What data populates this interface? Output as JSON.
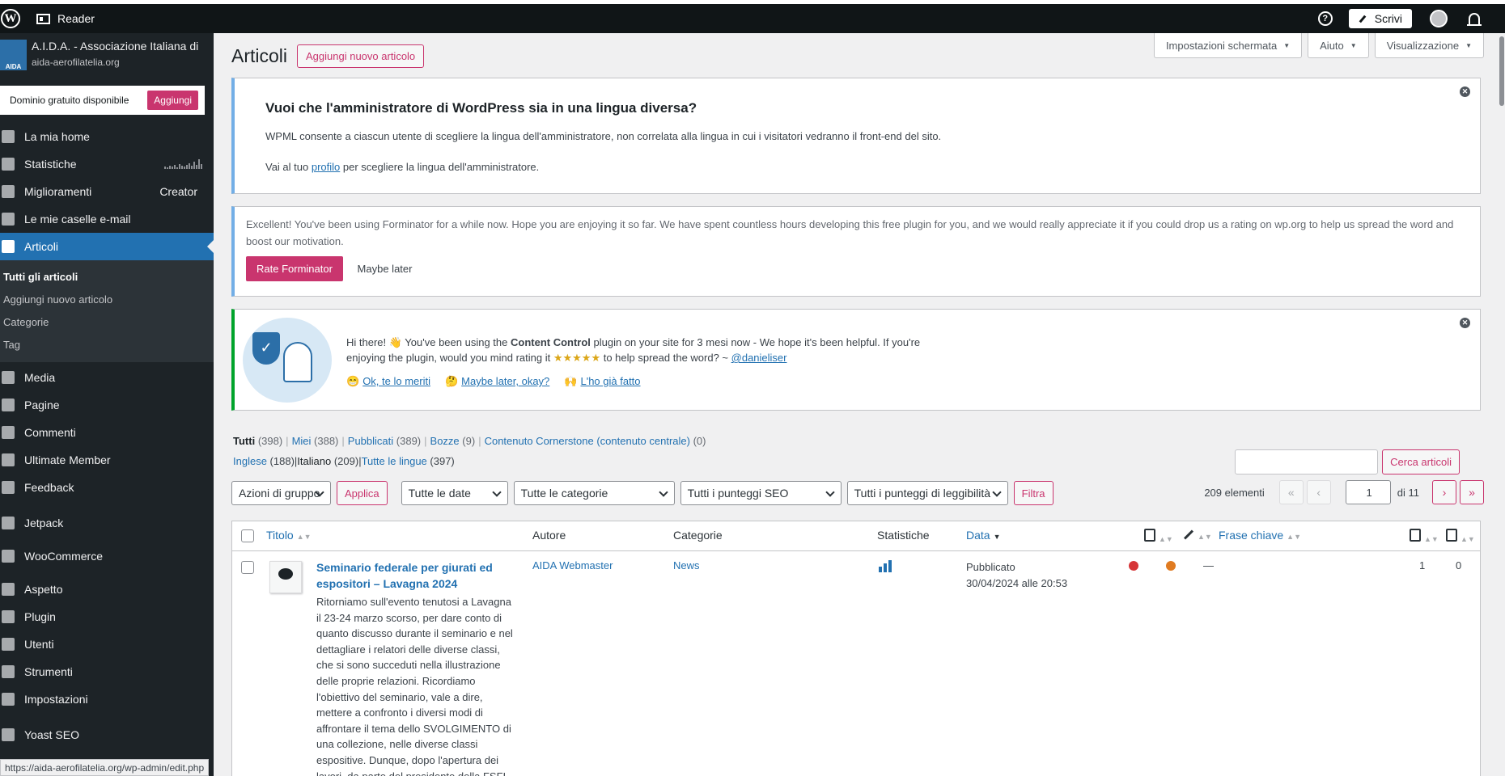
{
  "topbar": {
    "reader": "Reader",
    "write": "Scrivi",
    "help": "?"
  },
  "site": {
    "name": "A.I.D.A. - Associazione Italiana di",
    "url": "aida-aerofilatelia.org",
    "logo_text": "AIDA"
  },
  "promo": {
    "text": "Dominio gratuito disponibile",
    "button": "Aggiungi"
  },
  "sidebar": {
    "items": [
      {
        "label": "La mia home",
        "icon": "home-icon"
      },
      {
        "label": "Statistiche",
        "icon": "stats-icon"
      },
      {
        "label": "Miglioramenti",
        "icon": "cart-icon",
        "extra": "Creator"
      },
      {
        "label": "Le mie caselle e-mail",
        "icon": "mail-icon"
      },
      {
        "label": "Articoli",
        "icon": "pin-icon"
      }
    ],
    "submenu": [
      "Tutti gli articoli",
      "Aggiungi nuovo articolo",
      "Categorie",
      "Tag"
    ],
    "items2": [
      {
        "label": "Media",
        "icon": "media-icon"
      },
      {
        "label": "Pagine",
        "icon": "page-icon"
      },
      {
        "label": "Commenti",
        "icon": "comment-icon"
      },
      {
        "label": "Ultimate Member",
        "icon": "user-icon"
      },
      {
        "label": "Feedback",
        "icon": "feedback-icon"
      },
      {
        "label": "Jetpack",
        "icon": "jetpack-icon"
      },
      {
        "label": "WooCommerce",
        "icon": "woo-icon"
      },
      {
        "label": "Aspetto",
        "icon": "brush-icon"
      },
      {
        "label": "Plugin",
        "icon": "plugin-icon"
      },
      {
        "label": "Utenti",
        "icon": "users-icon"
      },
      {
        "label": "Strumenti",
        "icon": "tools-icon"
      },
      {
        "label": "Impostazioni",
        "icon": "settings-icon"
      },
      {
        "label": "Yoast SEO",
        "icon": "yoast-icon"
      }
    ]
  },
  "statusbar": "https://aida-aerofilatelia.org/wp-admin/edit.php",
  "screen_options": [
    "Impostazioni schermata",
    "Aiuto",
    "Visualizzazione"
  ],
  "page": {
    "title": "Articoli",
    "add_new": "Aggiungi nuovo articolo"
  },
  "notice_wpml": {
    "title": "Vuoi che l'amministratore di WordPress sia in una lingua diversa?",
    "body": "WPML consente a ciascun utente di scegliere la lingua dell'amministratore, non correlata alla lingua in cui i visitatori vedranno il front-end del sito.",
    "link_pre": "Vai al tuo ",
    "link": "profilo",
    "link_post": " per scegliere la lingua dell'amministratore."
  },
  "notice_forminator": {
    "body": "Excellent! You've been using Forminator for a while now. Hope you are enjoying it so far. We have spent countless hours developing this free plugin for you, and we would really appreciate it if you could drop us a rating on wp.org to help us spread the word and boost our motivation.",
    "rate": "Rate Forminator",
    "later": "Maybe later"
  },
  "notice_cc": {
    "pre": "Hi there! 👋 You've been using the ",
    "plugin": "Content Control",
    "mid": " plugin on your site for 3 mesi now - We hope it's been helpful. If you're enjoying the plugin, would you mind rating it ",
    "stars": "★★★★★",
    "post": " to help spread the word? ~ ",
    "author": "@danieliser",
    "links": [
      {
        "emoji": "😁",
        "label": "Ok, te lo meriti"
      },
      {
        "emoji": "🤔",
        "label": "Maybe later, okay?"
      },
      {
        "emoji": "🙌",
        "label": "L'ho già fatto"
      }
    ]
  },
  "views": [
    {
      "label": "Tutti",
      "count": "(398)"
    },
    {
      "label": "Miei",
      "count": "(388)"
    },
    {
      "label": "Pubblicati",
      "count": "(389)"
    },
    {
      "label": "Bozze",
      "count": "(9)"
    },
    {
      "label": "Contenuto Cornerstone (contenuto centrale)",
      "count": "(0)"
    }
  ],
  "langs": [
    {
      "label": "Inglese",
      "count": "(188)"
    },
    {
      "label": "Italiano",
      "count": "(209)"
    },
    {
      "label": "Tutte le lingue",
      "count": "(397)"
    }
  ],
  "search": {
    "button": "Cerca articoli"
  },
  "filters": {
    "bulk": "Azioni di gruppo",
    "apply": "Applica",
    "dates": "Tutte le date",
    "cats": "Tutte le categorie",
    "seo": "Tutti i punteggi SEO",
    "read": "Tutti i punteggi di leggibilità",
    "filter": "Filtra"
  },
  "pager": {
    "count": "209 elementi",
    "page": "1",
    "of": "di 11",
    "first": "«",
    "prev": "‹",
    "next": "›",
    "last": "»"
  },
  "table": {
    "headers": {
      "title": "Titolo",
      "author": "Autore",
      "cats": "Categorie",
      "stats": "Statistiche",
      "date": "Data",
      "keyphrase": "Frase chiave"
    },
    "row": {
      "title": "Seminario federale per giurati ed espositori – Lavagna 2024",
      "excerpt": [
        "Ritorniamo sull'evento tenutosi a Lavagna",
        "il 23-24 marzo scorso, per dare conto di",
        "quanto discusso durante il seminario e nel",
        "dettagliare i relatori delle diverse classi,",
        "che si sono succeduti nella illustrazione",
        "delle proprie relazioni. Ricordiamo",
        "l'obiettivo del seminario, vale a dire,",
        "mettere a confronto i diversi modi di",
        "affrontare il tema dello SVOLGIMENTO di",
        "una collezione, nelle diverse classi",
        "espositive. Dunque, dopo l'apertura dei",
        "lavori, da parte del presidente della FSFI"
      ],
      "author": "AIDA Webmaster",
      "category": "News",
      "status": "Pubblicato",
      "date": "30/04/2024 alle 20:53",
      "seo_color": "#d63638",
      "read_color": "#e07b21",
      "keyphrase": "—",
      "links_in": "1",
      "links_out": "0"
    }
  }
}
